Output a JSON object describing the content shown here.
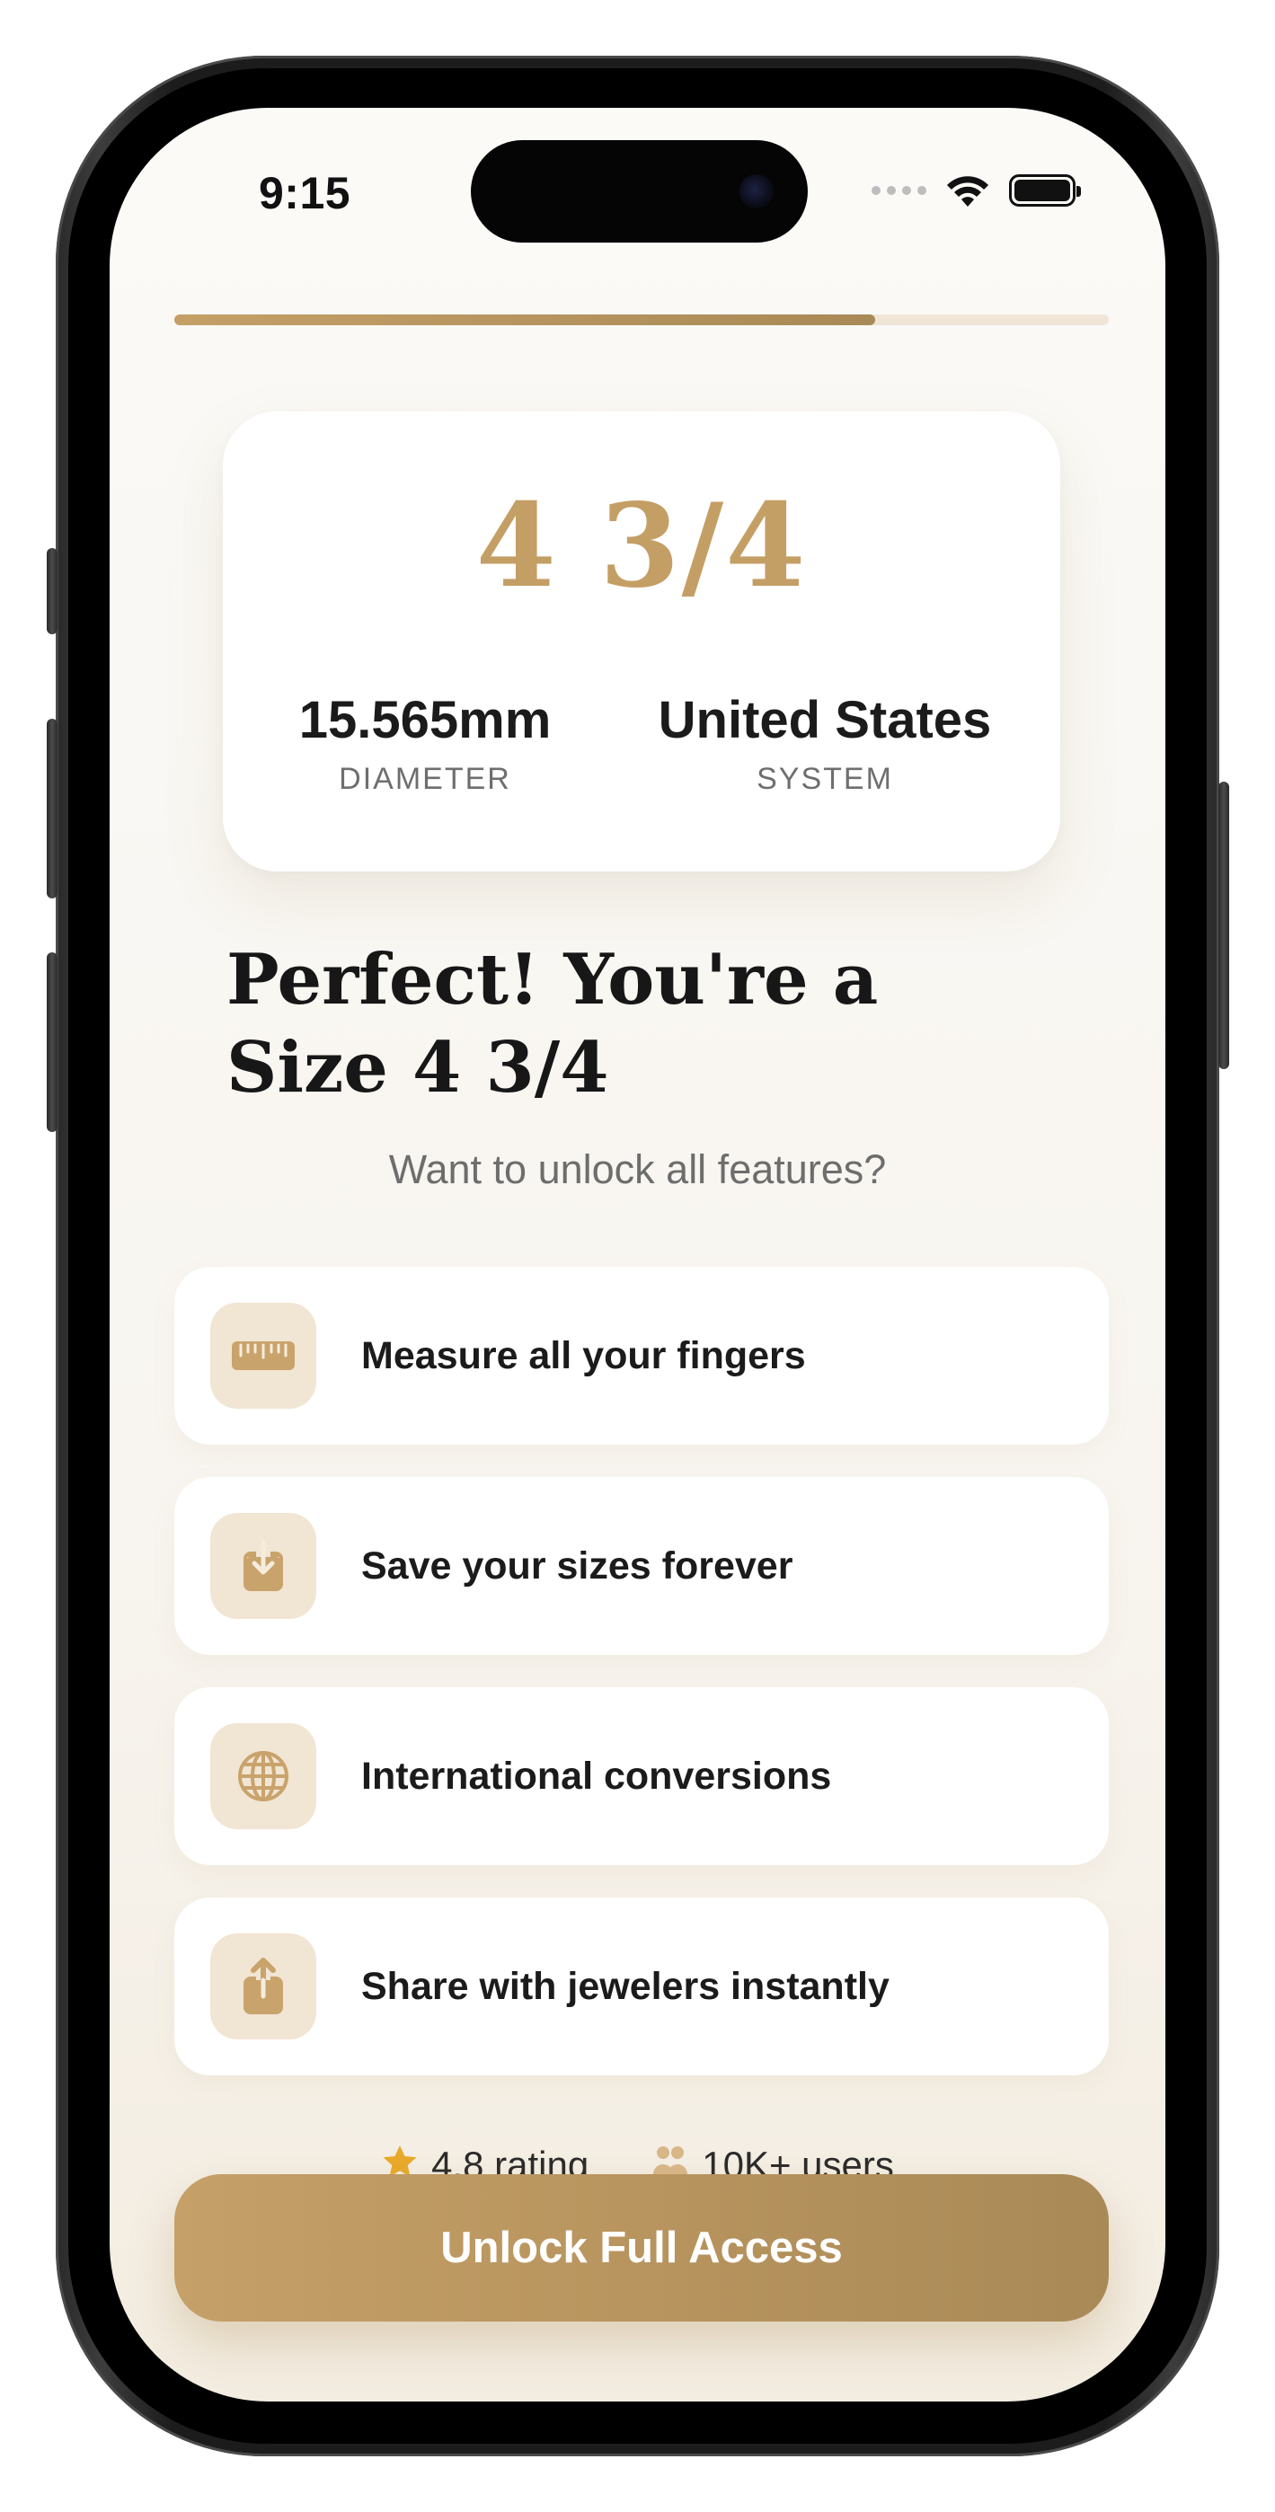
{
  "status_bar": {
    "time": "9:15"
  },
  "progress": {
    "fraction": 0.75
  },
  "result": {
    "size": "4 3/4",
    "diameter_value": "15.565mm",
    "diameter_label": "DIAMETER",
    "system_value": "United States",
    "system_label": "SYSTEM"
  },
  "headline": "Perfect! You're a Size 4 3/4",
  "subheadline": "Want to unlock all features?",
  "features": [
    {
      "label": "Measure all your fingers",
      "icon": "ruler-icon"
    },
    {
      "label": "Save your sizes forever",
      "icon": "save-download-icon"
    },
    {
      "label": "International conversions",
      "icon": "globe-icon"
    },
    {
      "label": "Share with jewelers instantly",
      "icon": "share-icon"
    }
  ],
  "social_proof": {
    "rating": "4.8 rating",
    "users": "10K+ users"
  },
  "cta": {
    "label": "Unlock Full Access"
  },
  "colors": {
    "accent_gold": "#c49f65",
    "icon_bg": "#f1e5d3",
    "background": "#fbfaf7",
    "text_dark": "#1b1b1b"
  }
}
